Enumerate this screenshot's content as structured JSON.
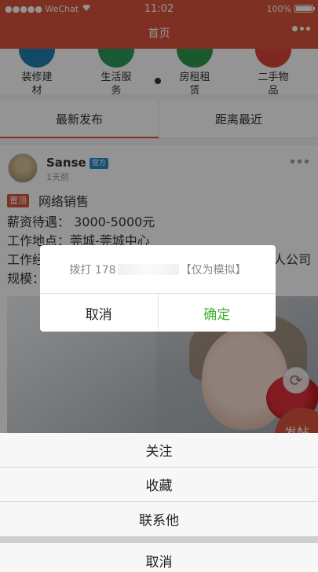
{
  "status_bar": {
    "carrier": "●●●●● WeChat",
    "time": "11:02",
    "battery": "100%"
  },
  "nav": {
    "title": "首页"
  },
  "categories": [
    {
      "label_line1": "装修建",
      "label_line2": "材",
      "color": "#1f7fb0"
    },
    {
      "label_line1": "生活服",
      "label_line2": "务",
      "color": "#2e9a5c"
    },
    {
      "label_line1": "房租租",
      "label_line2": "赁",
      "color": "#2f9a4c"
    },
    {
      "label_line1": "二手物",
      "label_line2": "品",
      "color": "#d9453a"
    }
  ],
  "tabs": [
    {
      "label": "最新发布",
      "active": true
    },
    {
      "label": "距离最近",
      "active": false
    }
  ],
  "post": {
    "username": "Sanse",
    "badge": "官方",
    "time": "1天前",
    "tag": "置顶",
    "title": "网络销售",
    "salary": "薪资待遇： 3000-5000元",
    "location": "工作地点：莞城-莞城中心",
    "company": "工作经…",
    "company_suffix": "人公司",
    "scale": "规模："
  },
  "fab_label": "发帖",
  "dialog": {
    "message_prefix": "拨打 178",
    "message_suffix": "【仅为模拟】",
    "cancel": "取消",
    "confirm": "确定"
  },
  "action_sheet": {
    "items": [
      "关注",
      "收藏",
      "联系他"
    ],
    "cancel": "取消"
  },
  "colors": {
    "brand": "#d9533d",
    "confirm": "#3cb034"
  }
}
